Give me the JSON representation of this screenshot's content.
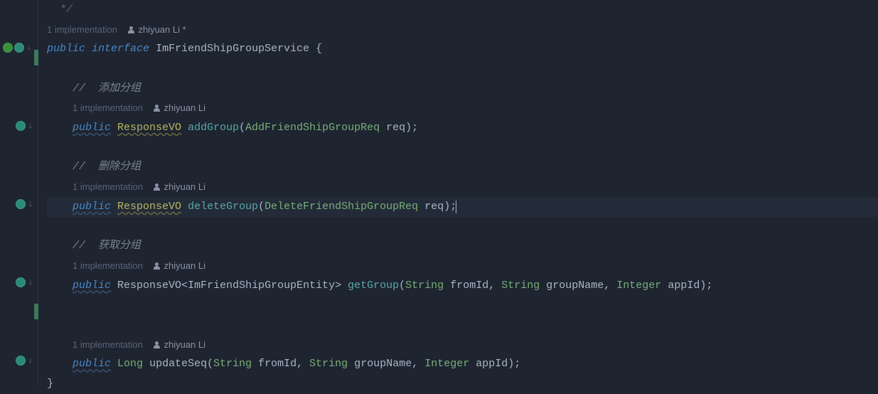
{
  "lines": {
    "l0": {
      "comment_end": "*/"
    },
    "l1": {
      "hint_impl": "1 implementation",
      "hint_author": "zhiyuan Li *"
    },
    "l2": {
      "kw_public": "public",
      "kw_interface": "interface",
      "class_name": "ImFriendShipGroupService",
      "brace": " {"
    },
    "l4": {
      "comment": "//  添加分组"
    },
    "l5": {
      "hint_impl": "1 implementation",
      "hint_author": "zhiyuan Li"
    },
    "l6": {
      "kw_public": "public",
      "ret": "ResponseVO",
      "method": "addGroup",
      "p1_type": "AddFriendShipGroupReq",
      "p1_name": "req"
    },
    "l8": {
      "comment": "//  删除分组"
    },
    "l9": {
      "hint_impl": "1 implementation",
      "hint_author": "zhiyuan Li"
    },
    "l10": {
      "kw_public": "public",
      "ret": "ResponseVO",
      "method": "deleteGroup",
      "p1_type": "DeleteFriendShipGroupReq",
      "p1_name": "req"
    },
    "l12": {
      "comment": "//  获取分组"
    },
    "l13": {
      "hint_impl": "1 implementation",
      "hint_author": "zhiyuan Li"
    },
    "l14": {
      "kw_public": "public",
      "ret": "ResponseVO",
      "generic": "ImFriendShipGroupEntity",
      "method": "getGroup",
      "p1_type": "String",
      "p1_name": "fromId",
      "p2_type": "String",
      "p2_name": "groupName",
      "p3_type": "Integer",
      "p3_name": "appId"
    },
    "l17": {
      "hint_impl": "1 implementation",
      "hint_author": "zhiyuan Li"
    },
    "l18": {
      "kw_public": "public",
      "ret": "Long",
      "method": "updateSeq",
      "p1_type": "String",
      "p1_name": "fromId",
      "p2_type": "String",
      "p2_name": "groupName",
      "p3_type": "Integer",
      "p3_name": "appId"
    },
    "l19": {
      "brace": "}"
    }
  }
}
